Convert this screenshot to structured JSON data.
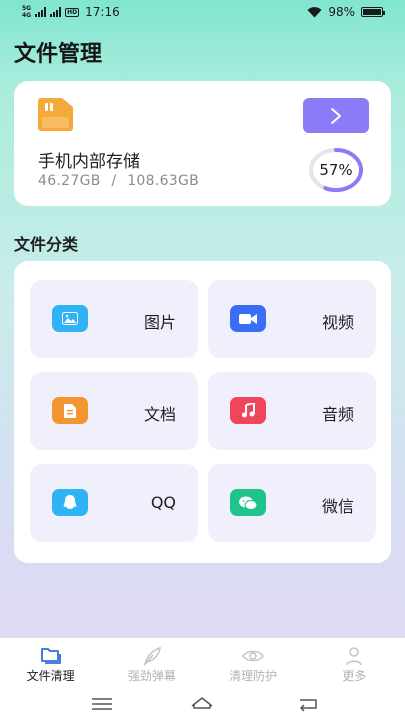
{
  "status_bar": {
    "network_top": "5G",
    "network_bottom": "4G",
    "hd": "HD",
    "time": "17:16",
    "battery": "98%",
    "battery_level": 0.98
  },
  "page": {
    "title": "文件管理"
  },
  "storage": {
    "name": "手机内部存储",
    "used": "46.27GB",
    "separator": "/",
    "total": "108.63GB",
    "usage_text": "57%",
    "usage_fraction": 0.57,
    "icons": {
      "folder": "sd-card-folder-icon",
      "go": "chevron-right-icon"
    },
    "colors": {
      "button": "#8a7cf6",
      "ring": "#8a7cf6",
      "ring_track": "#e4e4ea",
      "folder": "#f5a93b"
    }
  },
  "categories": {
    "title": "文件分类",
    "items": [
      {
        "label": "图片",
        "icon": "image-icon",
        "color": "#2fb3f5"
      },
      {
        "label": "视频",
        "icon": "video-camera-icon",
        "color": "#3b6ef6"
      },
      {
        "label": "文档",
        "icon": "document-icon",
        "color": "#f5952f"
      },
      {
        "label": "音频",
        "icon": "music-note-icon",
        "color": "#f0455a"
      },
      {
        "label": "QQ",
        "icon": "qq-penguin-icon",
        "color": "#2fb3f5"
      },
      {
        "label": "微信",
        "icon": "wechat-icon",
        "color": "#20c48a"
      }
    ]
  },
  "bottom_nav": {
    "items": [
      {
        "label": "文件清理",
        "icon": "folders-icon",
        "active": true
      },
      {
        "label": "强劲弹幕",
        "icon": "feather-icon",
        "active": false
      },
      {
        "label": "清理防护",
        "icon": "eye-icon",
        "active": false
      },
      {
        "label": "更多",
        "icon": "person-icon",
        "active": false
      }
    ]
  }
}
